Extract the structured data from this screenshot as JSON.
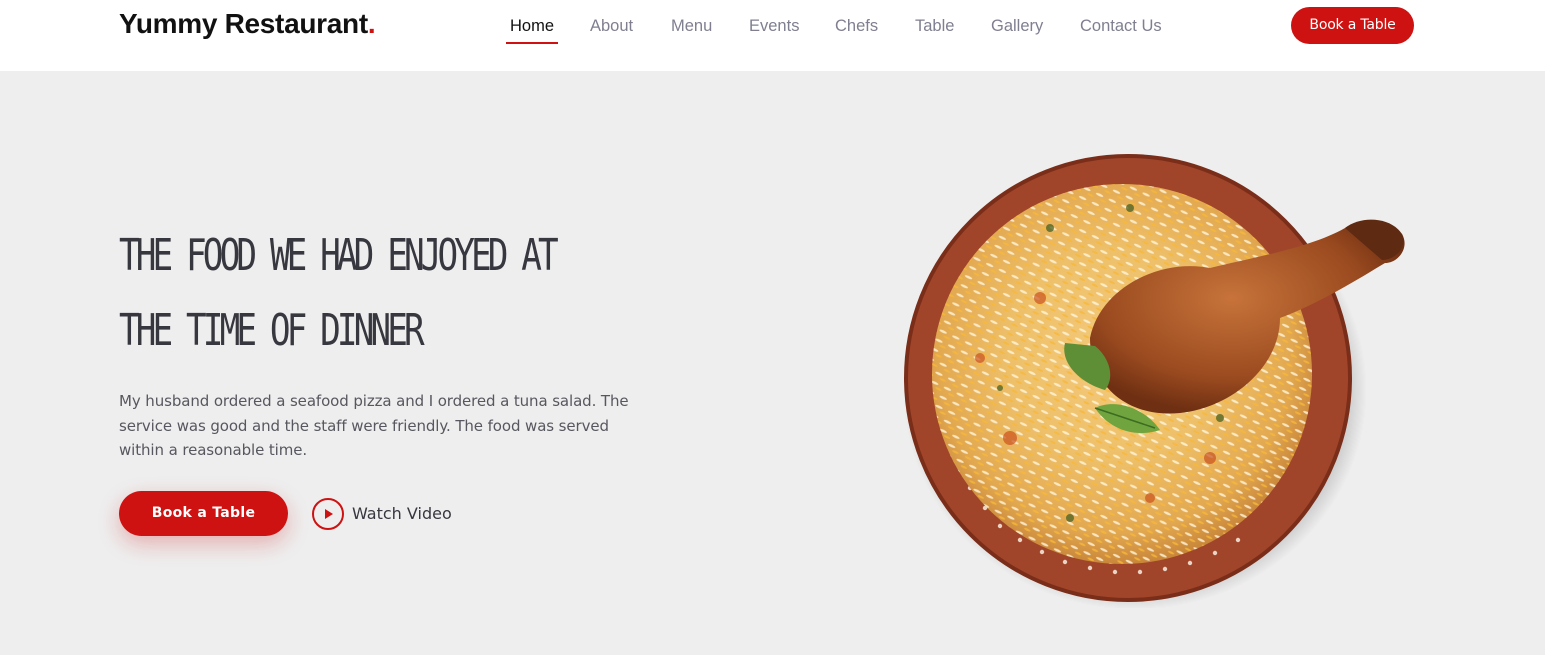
{
  "header": {
    "logo_text": "Yummy Restaurant",
    "logo_dot": ".",
    "nav": [
      "Home",
      "About",
      "Menu",
      "Events",
      "Chefs",
      "Table",
      "Gallery",
      "Contact Us"
    ],
    "active_nav": "Home",
    "cta_label": "Book a Table"
  },
  "hero": {
    "title_line1": "The Food we had enjoyed at",
    "title_line2": "the time of dinner",
    "description": "My husband ordered a seafood pizza and I ordered a tuna salad. The service was good and the staff were friendly. The food was served within a reasonable time.",
    "book_label": "Book a Table",
    "watch_label": "Watch Video",
    "play_icon": "play-circle-icon",
    "image_alt": "bowl of chicken biryani"
  },
  "colors": {
    "accent": "#ce1212",
    "heading": "#37373f",
    "nav_inactive": "#7f7f90",
    "background": "#eeeeee"
  }
}
